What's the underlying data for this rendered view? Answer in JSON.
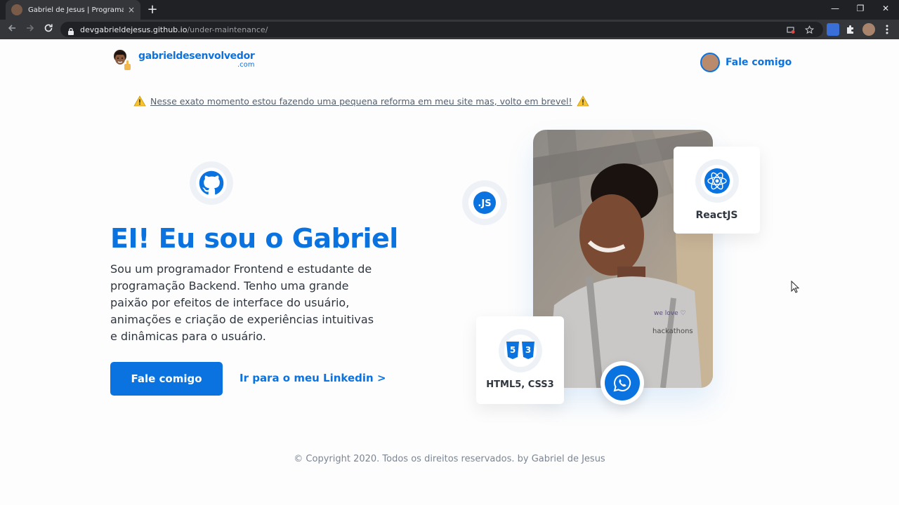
{
  "browser": {
    "tab_title": "Gabriel de Jesus | Programador F",
    "tab_close": "×",
    "new_tab": "+",
    "url_host": "devgabrieldejesus.github.io",
    "url_path": "/under-maintenance/",
    "win_min": "—",
    "win_restore": "❐",
    "win_close": "✕"
  },
  "header": {
    "logo_main": "gabrieldesenvolvedor",
    "logo_sub": ".com",
    "cta_label": "Fale comigo"
  },
  "notice": {
    "text": "Nesse exato momento estou fazendo uma pequena reforma em meu site mas, volto em brevel!"
  },
  "hero": {
    "title": "EI! Eu sou o Gabriel",
    "description": "Sou um programador Frontend e estudante de programação Backend. Tenho uma grande paixão por efeitos de interface do usuário, animações e criação de experiências intuitivas e dinâmicas para o usuário.",
    "primary_button": "Fale comigo",
    "secondary_link": "Ir para o meu Linkedin >"
  },
  "skills": {
    "react_label": "ReactJS",
    "html_label": "HTML5, CSS3"
  },
  "footer": {
    "text": "© Copyright 2020. Todos os direitos reservados. by Gabriel de Jesus"
  },
  "colors": {
    "brand": "#0b73e0",
    "text": "#2f3640",
    "chrome_dark": "#202124",
    "chrome_mid": "#35363a"
  }
}
